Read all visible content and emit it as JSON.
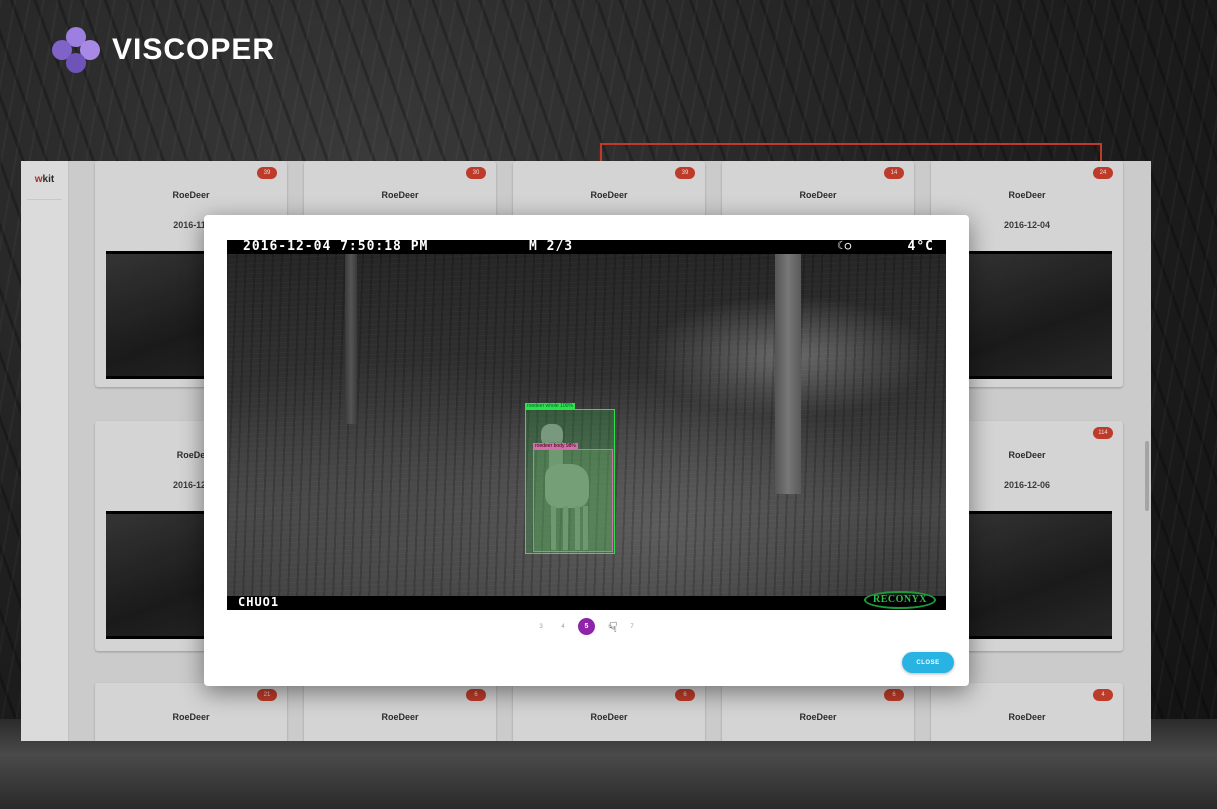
{
  "brand": {
    "name": "VISCOPER",
    "sidebar_logo_prefix": "w",
    "sidebar_logo_suffix": "kit"
  },
  "cards": [
    {
      "badge": "39",
      "title": "RoeDeer",
      "date": "2016-11-"
    },
    {
      "badge": "30",
      "title": "RoeDeer",
      "date": ""
    },
    {
      "badge": "39",
      "title": "RoeDeer",
      "date": ""
    },
    {
      "badge": "14",
      "title": "RoeDeer",
      "date": ""
    },
    {
      "badge": "24",
      "title": "RoeDeer",
      "date": "2016-12-04"
    },
    {
      "badge": "",
      "title": "RoeDe",
      "date": "2016-12-"
    },
    {
      "badge": "114",
      "title": "RoeDeer",
      "date": "2016-12-06"
    },
    {
      "badge": "21",
      "title": "RoeDeer",
      "date": ""
    },
    {
      "badge": "6",
      "title": "RoeDeer",
      "date": ""
    },
    {
      "badge": "6",
      "title": "RoeDeer",
      "date": ""
    },
    {
      "badge": "6",
      "title": "RoeDeer",
      "date": ""
    },
    {
      "badge": "4",
      "title": "RoeDeer",
      "date": ""
    }
  ],
  "modal": {
    "photo": {
      "timestamp": "2016-12-04 7:50:18 PM",
      "frame": "M 2/3",
      "moon": "☾○",
      "temperature": "4°C",
      "camera": "CHUO1",
      "camera_brand": "RECONYX",
      "detections": [
        {
          "label": "roedeer whole 100%"
        },
        {
          "label": "roedeer body 98%"
        }
      ]
    },
    "pagination": {
      "pages": [
        "3",
        "4",
        "5",
        "6",
        "7"
      ],
      "active": "5"
    },
    "close_label": "CLOSE"
  },
  "colors": {
    "accent": "#8e24aa",
    "close": "#29b3e3",
    "badge": "#d9442f",
    "whole_box": "#2ee04a",
    "body_box": "#d46fae"
  }
}
